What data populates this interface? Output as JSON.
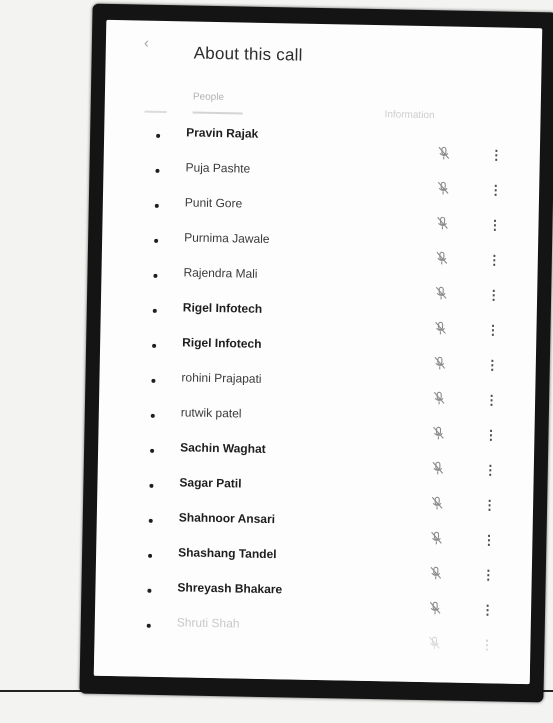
{
  "header": {
    "back_icon": "arrow-left-icon",
    "title": "About this call"
  },
  "tabs": {
    "people": "People",
    "information": "Information"
  },
  "people": [
    {
      "name": "Pravin Rajak",
      "muted": true
    },
    {
      "name": "Puja Pashte",
      "muted": true
    },
    {
      "name": "Punit Gore",
      "muted": true
    },
    {
      "name": "Purnima Jawale",
      "muted": true
    },
    {
      "name": "Rajendra Mali",
      "muted": true
    },
    {
      "name": "Rigel Infotech",
      "muted": true
    },
    {
      "name": "Rigel Infotech",
      "muted": true
    },
    {
      "name": "rohini Prajapati",
      "muted": true
    },
    {
      "name": "rutwik patel",
      "muted": true
    },
    {
      "name": "Sachin Waghat",
      "muted": true
    },
    {
      "name": "Sagar Patil",
      "muted": true
    },
    {
      "name": "Shahnoor Ansari",
      "muted": true
    },
    {
      "name": "Shashang Tandel",
      "muted": true
    },
    {
      "name": "Shreyash Bhakare",
      "muted": true
    },
    {
      "name": "Shruti Shah",
      "muted": true
    }
  ],
  "icons": {
    "mic": "mic-off-icon",
    "more": "more-vertical-icon"
  }
}
